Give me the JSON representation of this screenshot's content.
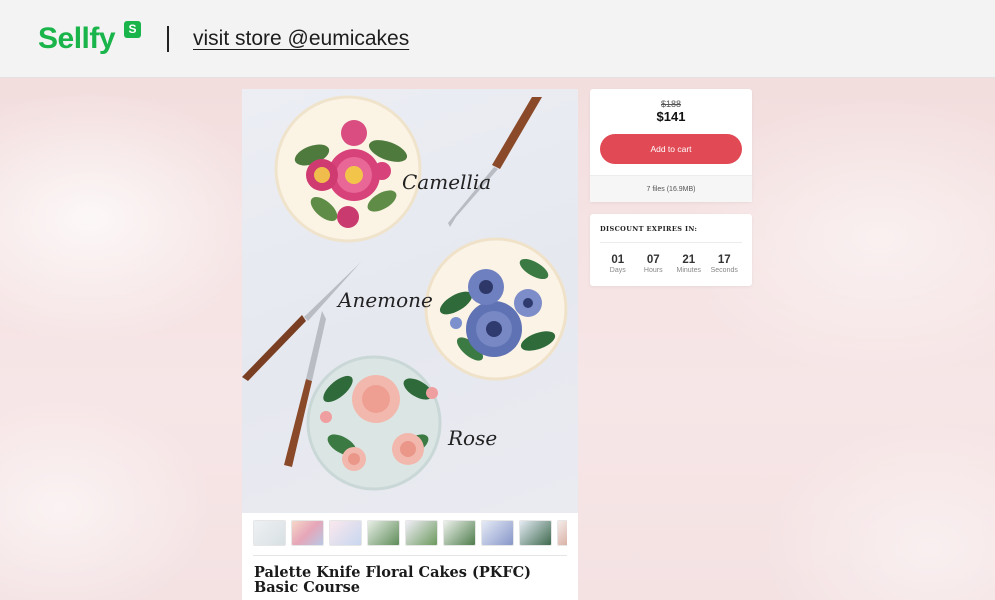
{
  "header": {
    "logo_text": "Sellfy",
    "logo_badge": "S",
    "visit_store_label": "visit store @eumicakes",
    "brand_color": "#19b44a"
  },
  "product": {
    "image_labels": {
      "camellia": "Camellia",
      "anemone": "Anemone",
      "rose": "Rose"
    },
    "title": "Palette Knife Floral Cakes (PKFC) Basic Course",
    "thumbnail_count": 9
  },
  "price": {
    "old_price": "$188",
    "new_price": "$141",
    "add_to_cart_label": "Add to cart",
    "files_info": "7 files (16.9MB)",
    "button_color": "#e14a55"
  },
  "discount": {
    "title": "DISCOUNT EXPIRES IN:",
    "countdown": [
      {
        "value": "01",
        "label": "Days"
      },
      {
        "value": "07",
        "label": "Hours"
      },
      {
        "value": "21",
        "label": "Minutes"
      },
      {
        "value": "17",
        "label": "Seconds"
      }
    ]
  }
}
